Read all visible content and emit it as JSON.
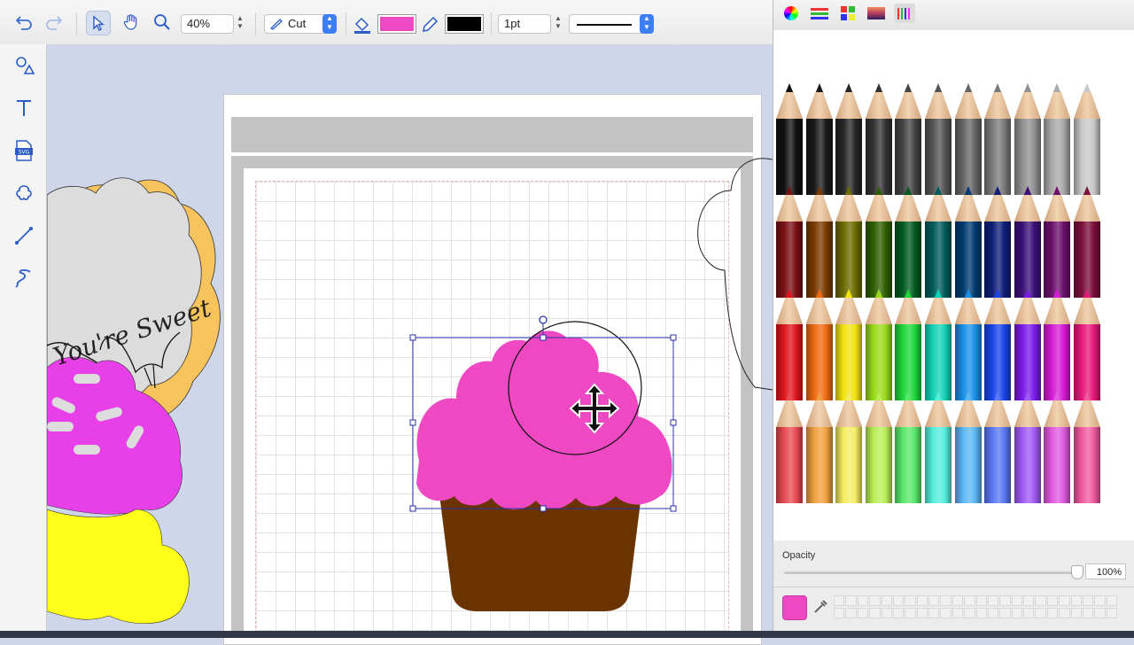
{
  "toolbar": {
    "zoom_value": "40%",
    "operation_label": "Cut",
    "fill_color": "#ee48c3",
    "stroke_color": "#000000",
    "stroke_width": "1pt"
  },
  "left_tools": [
    "shapes",
    "text",
    "svg-import",
    "trace",
    "line",
    "freehand"
  ],
  "canvas": {
    "artwork_text": "You're Sweet",
    "frosting_color": "#ee48c3",
    "cup_color": "#6b3300",
    "yellow_color": "#ffff1a",
    "magenta_color": "#e840e8"
  },
  "colors_panel": {
    "tabs": [
      "color-wheel",
      "color-sliders",
      "color-palettes",
      "image-palettes",
      "pencils"
    ],
    "opacity_label": "Opacity",
    "opacity_value": "100%",
    "selected_color": "#ee48c3",
    "pencil_rows": [
      [
        "#111111",
        "#1a1a1a",
        "#262626",
        "#333333",
        "#444444",
        "#555555",
        "#666666",
        "#7a7a7a",
        "#909090",
        "#a9a9a9",
        "#c8c8c8"
      ],
      [
        "#7a0f14",
        "#7a3a00",
        "#6b6b00",
        "#2f5e00",
        "#005a1f",
        "#005a5a",
        "#003a70",
        "#0f1e78",
        "#3a0f78",
        "#6b0f6b",
        "#7a0f3a"
      ],
      [
        "#e0151d",
        "#ef6a12",
        "#f2e20d",
        "#9ad918",
        "#1ed63a",
        "#12d3b7",
        "#1a8fe8",
        "#1a44e8",
        "#7a1ae8",
        "#d41ad4",
        "#e8177a"
      ],
      [
        "#e84a52",
        "#f0a040",
        "#f4ec60",
        "#b8ee55",
        "#5ae86b",
        "#55eedd",
        "#5ab8f4",
        "#5a78f4",
        "#a05af4",
        "#e05ae0",
        "#f05a9f"
      ]
    ]
  }
}
